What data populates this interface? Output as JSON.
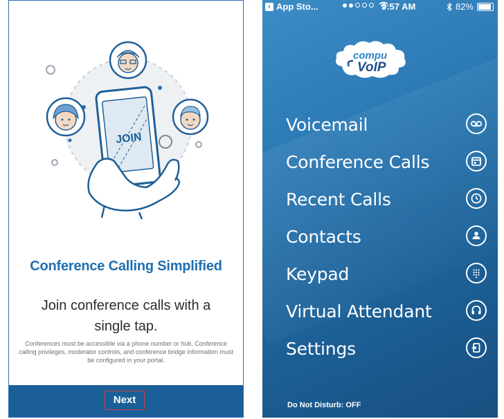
{
  "left": {
    "title": "Conference Calling Simplified",
    "subtitle": "Join conference calls with a single tap.",
    "fine_print": "Conferences must be accessible via a phone number or hub. Conference calling privileges, moderator controls, and conference bridge information must be configured in your portal.",
    "phone_text": "JOIN",
    "next_label": "Next"
  },
  "right": {
    "status": {
      "back_app": "App Sto...",
      "time": "9:57 AM",
      "battery": "82%"
    },
    "logo": {
      "line1": "compu",
      "line2": "VoIP"
    },
    "menu": [
      {
        "label": "Voicemail",
        "icon": "voicemail-icon"
      },
      {
        "label": "Conference Calls",
        "icon": "calendar-icon"
      },
      {
        "label": "Recent Calls",
        "icon": "clock-icon"
      },
      {
        "label": "Contacts",
        "icon": "person-icon"
      },
      {
        "label": "Keypad",
        "icon": "keypad-icon"
      },
      {
        "label": "Virtual Attendant",
        "icon": "headset-icon"
      },
      {
        "label": "Settings",
        "icon": "settings-icon"
      }
    ],
    "dnd_text": "Do Not Disturb: OFF"
  },
  "colors": {
    "accent_blue": "#1f6fb0",
    "footer_blue": "#1b5f99",
    "highlight_red": "#c7423d"
  }
}
